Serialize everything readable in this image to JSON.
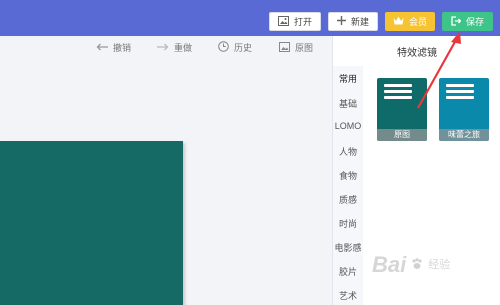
{
  "header": {
    "open_label": "打开",
    "new_label": "新建",
    "vip_label": "会员",
    "save_label": "保存"
  },
  "toolbar": {
    "undo_label": "撤销",
    "redo_label": "重做",
    "history_label": "历史",
    "original_label": "原图"
  },
  "panel": {
    "title": "特效滤镜",
    "categories": [
      "常用",
      "基础",
      "LOMO",
      "人物",
      "食物",
      "质感",
      "时尚",
      "电影感",
      "胶片",
      "艺术"
    ],
    "active_category_index": 0,
    "filters": [
      {
        "label": "原图"
      },
      {
        "label": "味蕾之旅"
      }
    ]
  },
  "watermark": {
    "logo": "Bai",
    "text": "经验"
  },
  "colors": {
    "topbar": "#5a6ad5",
    "save": "#3ec488",
    "vip": "#f6c332",
    "canvas_image": "#156a66",
    "arrow": "#e8383d"
  },
  "icons": {
    "open": "image-icon",
    "new": "plus-icon",
    "vip": "crown-icon",
    "save": "export-icon",
    "undo": "arrow-left-icon",
    "redo": "arrow-right-icon",
    "history": "clock-icon",
    "original": "image-icon"
  }
}
